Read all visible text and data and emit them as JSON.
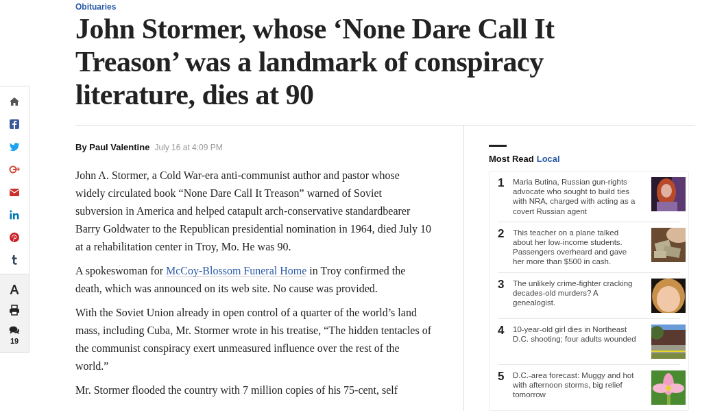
{
  "section": "Obituaries",
  "headline": "John Stormer, whose ‘None Dare Call It Treason’ was a landmark of conspiracy literature, dies at 90",
  "share_bar": {
    "comments_count": "19"
  },
  "byline": {
    "author": "By Paul Valentine",
    "time": "July 16 at 4:09 PM"
  },
  "paragraphs": [
    {
      "text": "John A. Stormer, a Cold War-era anti-communist author and pastor whose widely circulated book “None Dare Call It Treason” warned of Soviet subversion in America and helped catapult arch-conservative standardbearer Barry Goldwater to the Republican presidential nomination in 1964, died July 10 at a rehabilitation center in Troy, Mo. He was 90."
    },
    {
      "before": "A spokeswoman for ",
      "link": "McCoy-Blossom Funeral Home",
      "after": " in Troy confirmed the death, which was announced on its web site. No cause was provided."
    },
    {
      "text": "With the Soviet Union already in open control of a quarter of the world’s land mass, including Cuba, Mr. Stormer wrote in his treatise, “The hidden tentacles of the communist conspiracy exert unmeasured influence over the rest of the world.”"
    },
    {
      "text": "Mr. Stormer flooded the country with 7 million copies of his 75-cent, self"
    }
  ],
  "most_read": {
    "title": "Most Read",
    "section": "Local",
    "items": [
      {
        "rank": "1",
        "headline": "Maria Butina, Russian gun-rights advocate who sought to build ties with NRA, charged with acting as a covert Russian agent"
      },
      {
        "rank": "2",
        "headline": "This teacher on a plane talked about her low-income students. Passengers overheard and gave her more than $500 in cash."
      },
      {
        "rank": "3",
        "headline": "The unlikely crime-fighter cracking decades-old murders? A genealogist."
      },
      {
        "rank": "4",
        "headline": "10-year-old girl dies in Northeast D.C. shooting; four adults wounded"
      },
      {
        "rank": "5",
        "headline": "D.C.-area forecast: Muggy and hot with afternoon storms, big relief tomorrow"
      }
    ]
  }
}
